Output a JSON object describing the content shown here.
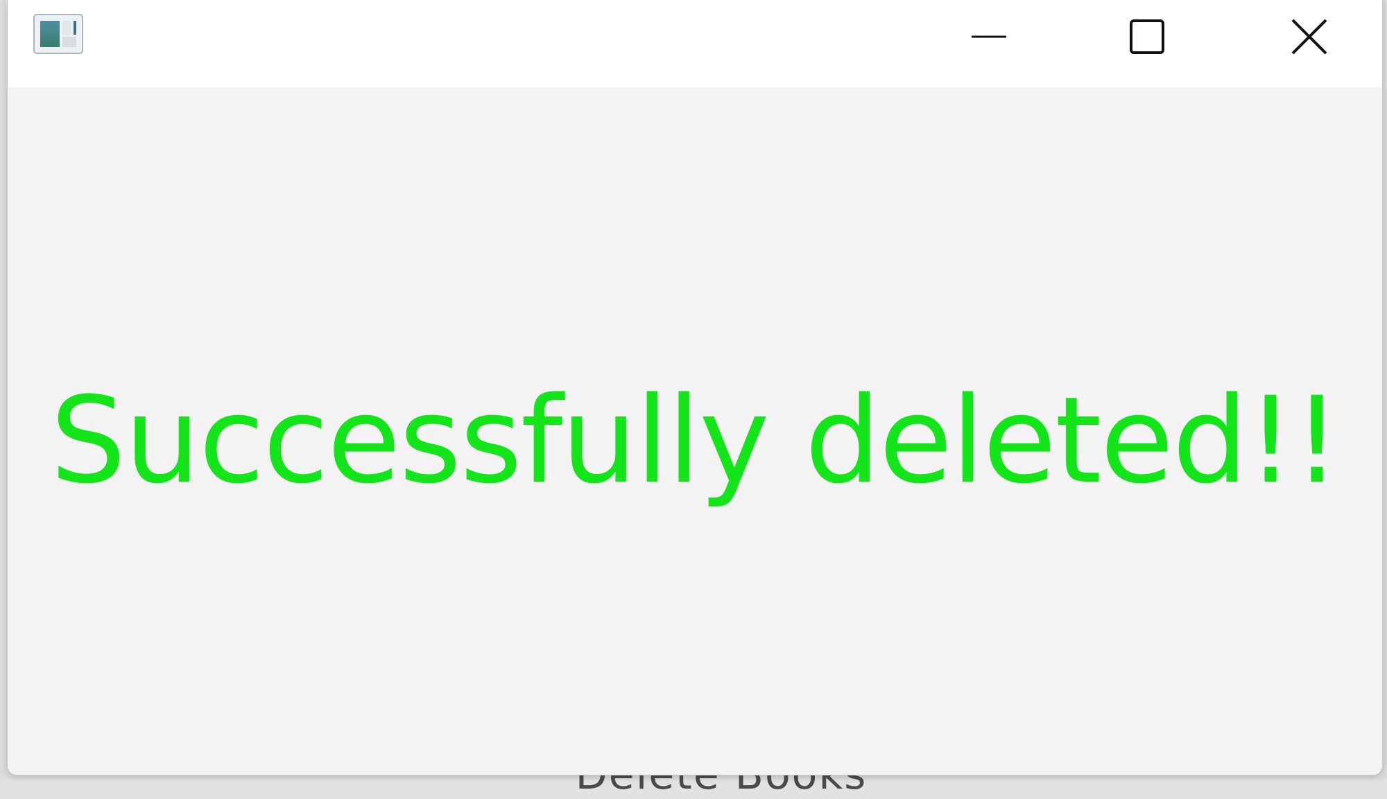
{
  "window": {
    "message": "Successfully deleted!!",
    "message_color": "#13e51a"
  },
  "titlebar": {
    "app_icon": "app-window-icon",
    "minimize_icon": "minimize-icon",
    "maximize_icon": "maximize-icon",
    "close_icon": "close-icon"
  },
  "background": {
    "peek_text": "Delete Books"
  }
}
